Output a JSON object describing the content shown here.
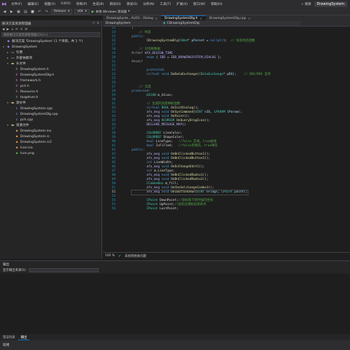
{
  "menubar": {
    "items": [
      "文件(F)",
      "编辑(E)",
      "视图(V)",
      "Git(G)",
      "项目(P)",
      "生成(B)",
      "调试(D)",
      "测试(S)",
      "分析(N)",
      "工具(T)",
      "扩展(X)",
      "窗口(W)",
      "帮助(H)"
    ],
    "search_label": "搜索",
    "app_title": "DrawingSystem"
  },
  "toolbar": {
    "config": "Release",
    "platform": "x64",
    "run_label": "本地 Windows 调试器"
  },
  "tabs": [
    {
      "label": "DrawingSyste...ALOG - Dialog",
      "active": false
    },
    {
      "label": "DrawingSystemDlg.h",
      "active": true
    },
    {
      "label": "DrawingSystemDlg.cpp",
      "active": false
    }
  ],
  "navbar": {
    "project": "DrawingSystem",
    "scope": "CDrawingSystemDlg"
  },
  "solution_explorer": {
    "title": "解决方案资源管理器",
    "search_placeholder": "搜索解决方案资源管理器(Ctrl+;)",
    "tree": [
      {
        "indent": 0,
        "twisty": "",
        "icon": "solution",
        "label": "解决方案 'DrawingSystem' (1 个项目，共 1 个)",
        "selected": false
      },
      {
        "indent": 0,
        "twisty": "▾",
        "icon": "project",
        "label": "DrawingSystem",
        "selected": false
      },
      {
        "indent": 1,
        "twisty": "▸",
        "icon": "ref",
        "label": "引用",
        "selected": false
      },
      {
        "indent": 1,
        "twisty": "▸",
        "icon": "ext",
        "label": "外部依赖项",
        "selected": false
      },
      {
        "indent": 1,
        "twisty": "▾",
        "icon": "folder",
        "label": "头文件",
        "selected": false
      },
      {
        "indent": 2,
        "twisty": "",
        "icon": "h",
        "label": "DrawingSystem.h",
        "selected": false
      },
      {
        "indent": 2,
        "twisty": "",
        "icon": "h",
        "label": "DrawingSystemDlg.h",
        "selected": false
      },
      {
        "indent": 2,
        "twisty": "",
        "icon": "h",
        "label": "framework.h",
        "selected": false
      },
      {
        "indent": 2,
        "twisty": "",
        "icon": "h",
        "label": "pch.h",
        "selected": false
      },
      {
        "indent": 2,
        "twisty": "",
        "icon": "h",
        "label": "Resource.h",
        "selected": false
      },
      {
        "indent": 2,
        "twisty": "",
        "icon": "h",
        "label": "targetver.h",
        "selected": false
      },
      {
        "indent": 1,
        "twisty": "▾",
        "icon": "folder",
        "label": "源文件",
        "selected": false
      },
      {
        "indent": 2,
        "twisty": "",
        "icon": "cpp",
        "label": "DrawingSystem.cpp",
        "selected": false
      },
      {
        "indent": 2,
        "twisty": "",
        "icon": "cpp",
        "label": "DrawingSystemDlg.cpp",
        "selected": false
      },
      {
        "indent": 2,
        "twisty": "",
        "icon": "cpp",
        "label": "pch.cpp",
        "selected": false
      },
      {
        "indent": 1,
        "twisty": "▾",
        "icon": "folder",
        "label": "资源文件",
        "selected": false
      },
      {
        "indent": 2,
        "twisty": "",
        "icon": "res",
        "label": "DrawingSystem.ico",
        "selected": false
      },
      {
        "indent": 2,
        "twisty": "",
        "icon": "res",
        "label": "DrawingSystem.rc",
        "selected": false
      },
      {
        "indent": 2,
        "twisty": "",
        "icon": "res",
        "label": "DrawingSystem.rc2",
        "selected": false
      },
      {
        "indent": 2,
        "twisty": "",
        "icon": "res",
        "label": "Icon.ico",
        "selected": false
      },
      {
        "indent": 2,
        "twisty": "",
        "icon": "img",
        "label": "Icon.png",
        "selected": false
      }
    ]
  },
  "code": [
    {
      "n": 13,
      "t": [
        [
          "pa",
          "{"
        ]
      ]
    },
    {
      "n": 14,
      "t": [
        [
          "cm",
          "    // 构造"
        ]
      ]
    },
    {
      "n": 15,
      "t": [
        [
          "kw",
          "public"
        ],
        [
          "pa",
          ":"
        ]
      ]
    },
    {
      "n": 16,
      "t": [
        [
          "code",
          "        "
        ],
        [
          "fn",
          "CDrawingSystemDlg"
        ],
        [
          "code",
          "("
        ],
        [
          "ty",
          "CWnd"
        ],
        [
          "code",
          "* "
        ],
        [
          "var",
          "pParent"
        ],
        [
          "code",
          " = "
        ],
        [
          "kw",
          "nullptr"
        ],
        [
          "code",
          ");  "
        ],
        [
          "cm",
          "// 标准构造函数"
        ]
      ]
    },
    {
      "n": 17,
      "t": [
        [
          "code",
          ""
        ]
      ]
    },
    {
      "n": 18,
      "t": [
        [
          "cm",
          "    // 对话框数据"
        ]
      ]
    },
    {
      "n": 19,
      "t": [
        [
          "pp",
          "#ifdef"
        ],
        [
          "code",
          " "
        ],
        [
          "mac",
          "AFX_DESIGN_TIME"
        ]
      ]
    },
    {
      "n": 20,
      "t": [
        [
          "code",
          "        "
        ],
        [
          "kw",
          "enum"
        ],
        [
          "code",
          " { "
        ],
        [
          "mac",
          "IDD"
        ],
        [
          "code",
          " = "
        ],
        [
          "mac",
          "IDD_DRAWINGSYSTEM_DIALOG"
        ],
        [
          "code",
          " };"
        ]
      ]
    },
    {
      "n": 21,
      "t": [
        [
          "pp",
          "#endif"
        ]
      ]
    },
    {
      "n": 22,
      "t": [
        [
          "code",
          ""
        ]
      ]
    },
    {
      "n": 23,
      "t": [
        [
          "kw",
          "        protected"
        ],
        [
          "pa",
          ":"
        ]
      ]
    },
    {
      "n": 24,
      "t": [
        [
          "code",
          "        "
        ],
        [
          "kw",
          "virtual"
        ],
        [
          "code",
          " "
        ],
        [
          "kw",
          "void"
        ],
        [
          "code",
          " "
        ],
        [
          "fn",
          "DoDataExchange"
        ],
        [
          "code",
          "("
        ],
        [
          "ty",
          "CDataExchange"
        ],
        [
          "code",
          "* "
        ],
        [
          "var",
          "pDX"
        ],
        [
          "code",
          ");    "
        ],
        [
          "cm",
          "// DDX/DDV 支持"
        ]
      ]
    },
    {
      "n": 25,
      "t": [
        [
          "code",
          ""
        ]
      ]
    },
    {
      "n": 26,
      "t": [
        [
          "code",
          ""
        ]
      ]
    },
    {
      "n": 27,
      "t": [
        [
          "cm",
          "    // 实现"
        ]
      ]
    },
    {
      "n": 28,
      "t": [
        [
          "kw",
          "protected"
        ],
        [
          "pa",
          ":"
        ]
      ]
    },
    {
      "n": 29,
      "t": [
        [
          "code",
          "        "
        ],
        [
          "ty",
          "HICON"
        ],
        [
          "code",
          " "
        ],
        [
          "mem",
          "m_hIcon"
        ],
        [
          "code",
          ";"
        ]
      ]
    },
    {
      "n": 30,
      "t": [
        [
          "code",
          ""
        ]
      ]
    },
    {
      "n": 31,
      "t": [
        [
          "cm",
          "        // 生成的消息映射函数"
        ]
      ]
    },
    {
      "n": 32,
      "t": [
        [
          "code",
          "        "
        ],
        [
          "kw",
          "virtual"
        ],
        [
          "code",
          " "
        ],
        [
          "ty",
          "BOOL"
        ],
        [
          "code",
          " "
        ],
        [
          "fn",
          "OnInitDialog"
        ],
        [
          "code",
          "();"
        ]
      ]
    },
    {
      "n": 33,
      "t": [
        [
          "code",
          "        "
        ],
        [
          "mac",
          "afx_msg"
        ],
        [
          "code",
          " "
        ],
        [
          "kw",
          "void"
        ],
        [
          "code",
          " "
        ],
        [
          "fn",
          "OnSysCommand"
        ],
        [
          "code",
          "("
        ],
        [
          "ty",
          "UINT"
        ],
        [
          "code",
          " "
        ],
        [
          "var",
          "nID"
        ],
        [
          "code",
          ", "
        ],
        [
          "ty",
          "LPARAM"
        ],
        [
          "code",
          " "
        ],
        [
          "var",
          "lParam"
        ],
        [
          "code",
          ");"
        ]
      ]
    },
    {
      "n": 34,
      "t": [
        [
          "code",
          "        "
        ],
        [
          "mac",
          "afx_msg"
        ],
        [
          "code",
          " "
        ],
        [
          "kw",
          "void"
        ],
        [
          "code",
          " "
        ],
        [
          "fn",
          "OnPaint"
        ],
        [
          "code",
          "();"
        ]
      ]
    },
    {
      "n": 35,
      "t": [
        [
          "code",
          "        "
        ],
        [
          "mac",
          "afx_msg"
        ],
        [
          "code",
          " "
        ],
        [
          "ty",
          "HCURSOR"
        ],
        [
          "code",
          " "
        ],
        [
          "fn",
          "OnQueryDragIcon"
        ],
        [
          "code",
          "();"
        ]
      ]
    },
    {
      "n": 36,
      "t": [
        [
          "code",
          "        "
        ],
        [
          "mac",
          "DECLARE_MESSAGE_MAP"
        ],
        [
          "code",
          "()"
        ]
      ]
    },
    {
      "n": 37,
      "t": [
        [
          "code",
          ""
        ]
      ]
    },
    {
      "n": 38,
      "t": [
        [
          "code",
          "        "
        ],
        [
          "ty",
          "COLORREF"
        ],
        [
          "code",
          " "
        ],
        [
          "mem",
          "LineColor"
        ],
        [
          "code",
          ";"
        ]
      ]
    },
    {
      "n": 39,
      "t": [
        [
          "code",
          "        "
        ],
        [
          "ty",
          "COLORREF"
        ],
        [
          "code",
          " "
        ],
        [
          "mem",
          "ShapeColor"
        ],
        [
          "code",
          ";"
        ]
      ]
    },
    {
      "n": 40,
      "t": [
        [
          "code",
          "        "
        ],
        [
          "kw",
          "bool"
        ],
        [
          "code",
          " "
        ],
        [
          "mem",
          "LineType"
        ],
        [
          "code",
          ";   "
        ],
        [
          "cm",
          "//false 实线，true虚线"
        ]
      ]
    },
    {
      "n": 41,
      "t": [
        [
          "code",
          "        "
        ],
        [
          "kw",
          "bool"
        ],
        [
          "code",
          " "
        ],
        [
          "mem",
          "IsFilled"
        ],
        [
          "code",
          ";   "
        ],
        [
          "cm",
          "//false无填充，true填充"
        ]
      ]
    },
    {
      "n": 42,
      "t": [
        [
          "kw",
          "public"
        ],
        [
          "pa",
          ":"
        ]
      ]
    },
    {
      "n": 43,
      "t": [
        [
          "code",
          "        "
        ],
        [
          "mac",
          "afx_msg"
        ],
        [
          "code",
          " "
        ],
        [
          "kw",
          "void"
        ],
        [
          "code",
          " "
        ],
        [
          "fn",
          "OnBnClickedButton1"
        ],
        [
          "code",
          "();"
        ]
      ]
    },
    {
      "n": 44,
      "t": [
        [
          "code",
          "        "
        ],
        [
          "mac",
          "afx_msg"
        ],
        [
          "code",
          " "
        ],
        [
          "kw",
          "void"
        ],
        [
          "code",
          " "
        ],
        [
          "fn",
          "OnBnClickedButton2"
        ],
        [
          "code",
          "();"
        ]
      ]
    },
    {
      "n": 45,
      "t": [
        [
          "code",
          "        "
        ],
        [
          "kw",
          "int"
        ],
        [
          "code",
          " "
        ],
        [
          "mem",
          "LineWidth"
        ],
        [
          "code",
          ";"
        ]
      ]
    },
    {
      "n": 46,
      "t": [
        [
          "code",
          "        "
        ],
        [
          "mac",
          "afx_msg"
        ],
        [
          "code",
          " "
        ],
        [
          "kw",
          "void"
        ],
        [
          "code",
          " "
        ],
        [
          "fn",
          "OnEnChangeEdit1"
        ],
        [
          "code",
          "();"
        ]
      ]
    },
    {
      "n": 47,
      "t": [
        [
          "code",
          "        "
        ],
        [
          "kw",
          "int"
        ],
        [
          "code",
          " "
        ],
        [
          "mem",
          "m_LineType"
        ],
        [
          "code",
          ";"
        ]
      ]
    },
    {
      "n": 48,
      "t": [
        [
          "code",
          "        "
        ],
        [
          "mac",
          "afx_msg"
        ],
        [
          "code",
          " "
        ],
        [
          "kw",
          "void"
        ],
        [
          "code",
          " "
        ],
        [
          "fn",
          "OnBnClickedRadio1"
        ],
        [
          "code",
          "();"
        ]
      ]
    },
    {
      "n": 49,
      "t": [
        [
          "code",
          "        "
        ],
        [
          "mac",
          "afx_msg"
        ],
        [
          "code",
          " "
        ],
        [
          "kw",
          "void"
        ],
        [
          "code",
          " "
        ],
        [
          "fn",
          "OnBnClickedRadio2"
        ],
        [
          "code",
          "();"
        ]
      ]
    },
    {
      "n": 50,
      "t": [
        [
          "code",
          "        "
        ],
        [
          "ty",
          "CComboBox"
        ],
        [
          "code",
          " "
        ],
        [
          "mem",
          "m_fill"
        ],
        [
          "code",
          ";"
        ]
      ]
    },
    {
      "n": 51,
      "t": [
        [
          "code",
          "        "
        ],
        [
          "mac",
          "afx_msg"
        ],
        [
          "code",
          " "
        ],
        [
          "kw",
          "void"
        ],
        [
          "code",
          " "
        ],
        [
          "fn",
          "OnCbnSelchangeCombo1"
        ],
        [
          "code",
          "();"
        ]
      ]
    },
    {
      "n": 52,
      "t": [
        [
          "code",
          "        "
        ],
        [
          "mac",
          "afx_msg"
        ],
        [
          "code",
          " "
        ],
        [
          "kw",
          "void"
        ],
        [
          "code",
          " "
        ],
        [
          "fn",
          "OnLButtonDown"
        ],
        [
          "code",
          "("
        ],
        [
          "ty",
          "UINT"
        ],
        [
          "code",
          " "
        ],
        [
          "var",
          "nFlags"
        ],
        [
          "code",
          ", "
        ],
        [
          "ty",
          "CPoint"
        ],
        [
          "code",
          " "
        ],
        [
          "var",
          "point"
        ],
        [
          "code",
          ");"
        ]
      ],
      "current": true
    },
    {
      "n": 53,
      "t": [
        [
          "code",
          ""
        ]
      ]
    },
    {
      "n": 54,
      "t": [
        [
          "code",
          "        "
        ],
        [
          "ty",
          "CPoint"
        ],
        [
          "code",
          " "
        ],
        [
          "mem",
          "DownPoint"
        ],
        [
          "code",
          ";"
        ],
        [
          "cm",
          "//鼠标按下的时候的坐标"
        ]
      ]
    },
    {
      "n": 55,
      "t": [
        [
          "code",
          "        "
        ],
        [
          "ty",
          "CPoint"
        ],
        [
          "code",
          " "
        ],
        [
          "mem",
          "UpPoint"
        ],
        [
          "code",
          ";"
        ],
        [
          "cm",
          "//鼠标左键松起来的点"
        ]
      ]
    },
    {
      "n": 56,
      "t": [
        [
          "code",
          "        "
        ],
        [
          "ty",
          "CPoint"
        ],
        [
          "code",
          " "
        ],
        [
          "mem",
          "LastPoint"
        ],
        [
          "code",
          ";"
        ]
      ]
    }
  ],
  "editor_status": {
    "zoom": "100 %",
    "issues": "未找到相关问题"
  },
  "output": {
    "title": "输出",
    "source_label": "显示输出来源(S):",
    "tabs": [
      "错误列表",
      "输出"
    ]
  },
  "statusbar": {
    "text": "就绪"
  }
}
